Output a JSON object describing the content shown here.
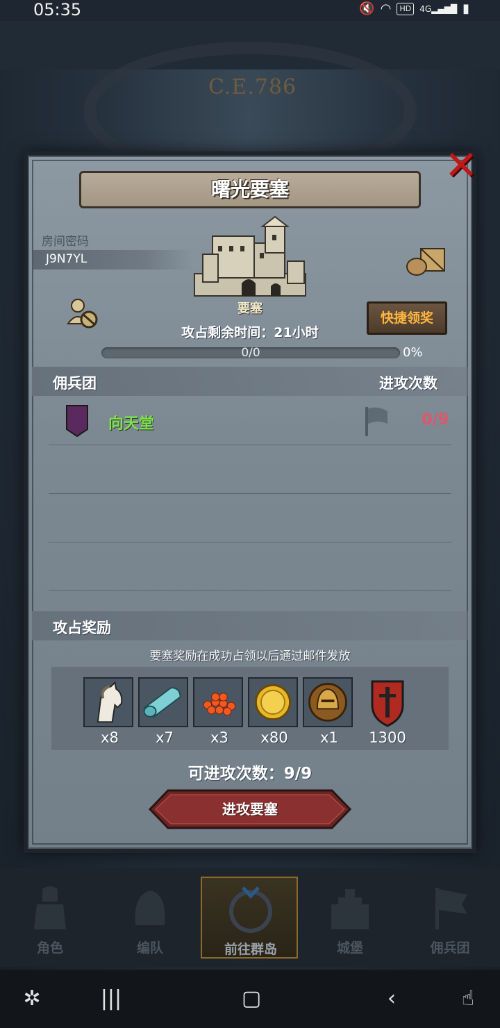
{
  "status_bar": {
    "time": "05:35",
    "icons": [
      "mute-icon",
      "wifi-icon",
      "hd-icon",
      "signal-4g-icon",
      "battery-icon"
    ],
    "hd_label": "HD",
    "network_label": "4G"
  },
  "backdrop": {
    "year_label": "C.E.786"
  },
  "dialog": {
    "title": "曙光要塞",
    "room_password_label": "房间密码",
    "room_code": "J9N7YL",
    "fortress_label": "要塞",
    "quick_claim_label": "快捷领奖",
    "time_remaining": "攻占剩余时间：21小时",
    "progress": {
      "count_text": "0/0",
      "percent_text": "0%",
      "value": 0
    },
    "mercenary_section": {
      "title": "佣兵团",
      "attack_count_header": "进攻次数"
    },
    "guilds": [
      {
        "name": "向天堂",
        "attacks": "0/9"
      }
    ],
    "reward_section": {
      "title": "攻占奖励",
      "note": "要塞奖励在成功占领以后通过邮件发放"
    },
    "rewards": [
      {
        "icon": "horse-icon",
        "qty": "x8"
      },
      {
        "icon": "cloth-icon",
        "qty": "x7"
      },
      {
        "icon": "roe-icon",
        "qty": "x3"
      },
      {
        "icon": "gold-coin-icon",
        "qty": "x80"
      },
      {
        "icon": "knight-helmet-icon",
        "qty": "x1"
      },
      {
        "icon": "sword-shield-icon",
        "qty": "1300"
      }
    ],
    "attacks_available": "可进攻次数：9/9",
    "attack_button_label": "进攻要塞"
  },
  "game_nav": {
    "tabs": [
      {
        "label": "角色",
        "icon": "knight-icon",
        "active": false
      },
      {
        "label": "编队",
        "icon": "helmet-icon",
        "active": false
      },
      {
        "label": "前往群岛",
        "icon": "compass-icon",
        "active": true
      },
      {
        "label": "城堡",
        "icon": "castle-icon",
        "active": false
      },
      {
        "label": "佣兵团",
        "icon": "flag-icon",
        "active": false
      }
    ]
  },
  "colors": {
    "dialog_bg": "#7c8892",
    "close_red": "#c01818",
    "guild_green": "#7ee050",
    "attack_count_red": "#e0566a",
    "claim_orange": "#ffb640",
    "button_red": "#7a2a2a"
  }
}
